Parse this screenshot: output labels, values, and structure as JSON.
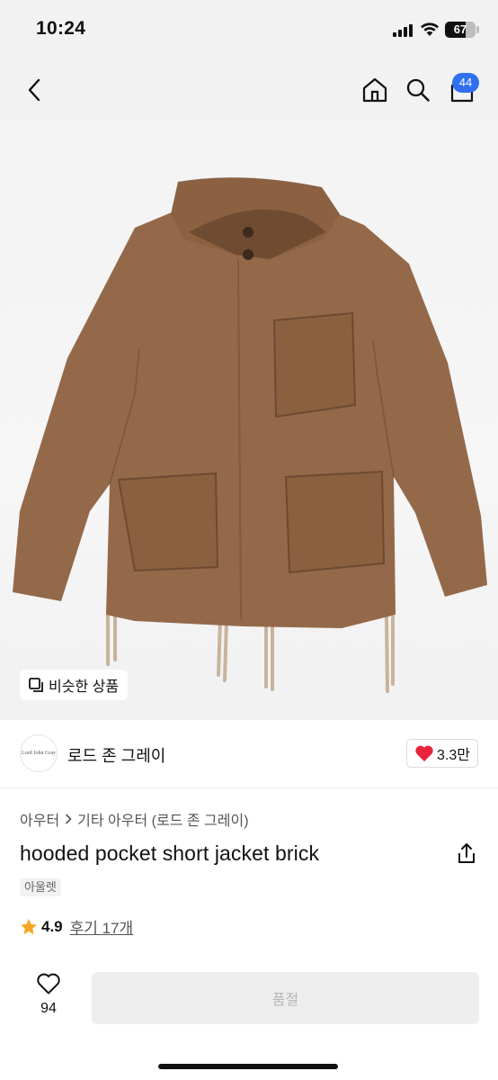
{
  "status_bar": {
    "time": "10:24",
    "battery_percent": "67",
    "battery_level": 0.67,
    "icons": [
      "signal-icon",
      "wifi-icon",
      "battery-icon"
    ]
  },
  "nav": {
    "icons": [
      "chevron-left-icon",
      "home-icon",
      "search-icon",
      "bag-icon"
    ],
    "cart_count": "44"
  },
  "hero": {
    "image_subject": "brown hooded jacket product photo",
    "similar_products_label": "비슷한 상품",
    "similar_icon": "copy-icon"
  },
  "brand": {
    "logo_text": "Lord John Gray",
    "name": "로드 존 그레이",
    "likes": "3.3만",
    "like_icon": "heart-icon"
  },
  "product": {
    "breadcrumb": [
      "아우터",
      "기타 아우터 (로드 존 그레이)"
    ],
    "breadcrumb_separator_icon": "chevron-right-icon",
    "title": "hooded pocket short jacket brick",
    "tag": "아울렛",
    "rating": "4.9",
    "rating_icon": "star-icon",
    "reviews": "후기 17개",
    "share_icon": "share-icon"
  },
  "bottom_bar": {
    "wish_count": "94",
    "wish_icon": "heart-outline-icon",
    "buy_button_label": "품절"
  },
  "colors": {
    "accent": "#2f6ff2",
    "heart": "#e8243c",
    "star": "#f5a623",
    "jacket": "#94694a"
  }
}
